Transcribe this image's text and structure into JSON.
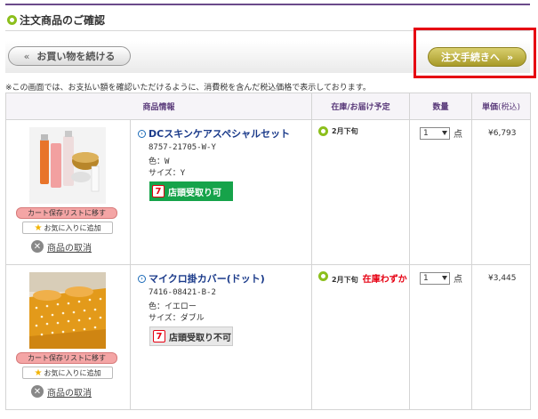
{
  "page": {
    "title": "注文商品のご確認",
    "notice": "※この画面では、お支払い額を確認いただけるように、消費税を含んだ税込価格で表示しております。"
  },
  "buttons": {
    "continue_shopping": "お買い物を続ける",
    "continue_arrow": "«",
    "checkout": "注文手続きへ",
    "checkout_arrow": "»"
  },
  "table": {
    "headers": {
      "info": "商品情報",
      "stock": "在庫/お届け予定",
      "qty": "数量",
      "price_main": "単価",
      "price_sub": "(税込)"
    },
    "rows": [
      {
        "name": "DCスキンケアスペシャルセット",
        "code": "8757-21705-W-Y",
        "color": "色：W",
        "size": "サイズ：Y",
        "pickup": "店頭受取り可",
        "pickup_ok": true,
        "stock": "2月下旬",
        "stock_note": "",
        "qty": "1",
        "unit": "点",
        "price": "¥6,793",
        "cart_save": "カート保存リストに移す",
        "favorite": "お気に入りに追加",
        "cancel": "商品の取消"
      },
      {
        "name": "マイクロ掛カバー(ドット)",
        "code": "7416-08421-B-2",
        "color": "色：イエロー",
        "size": "サイズ：ダブル",
        "pickup": "店頭受取り不可",
        "pickup_ok": false,
        "stock": "2月下旬",
        "stock_note": "在庫わずか",
        "qty": "1",
        "unit": "点",
        "price": "¥3,445",
        "cart_save": "カート保存リストに移す",
        "favorite": "お気に入りに追加",
        "cancel": "商品の取消"
      }
    ]
  },
  "icons": {
    "title": "circle-bullet-icon",
    "link": "link-arrow-icon",
    "stock": "stock-status-icon",
    "seven": "seven-eleven-icon",
    "fav": "star-icon",
    "cancel": "close-circle-icon"
  },
  "colors": {
    "accent_purple": "#6b4a8a",
    "green": "#8cbf1c",
    "checkout_gold": "#b0a32e",
    "highlight_red": "#e60012",
    "pickup_green": "#16a34a"
  }
}
